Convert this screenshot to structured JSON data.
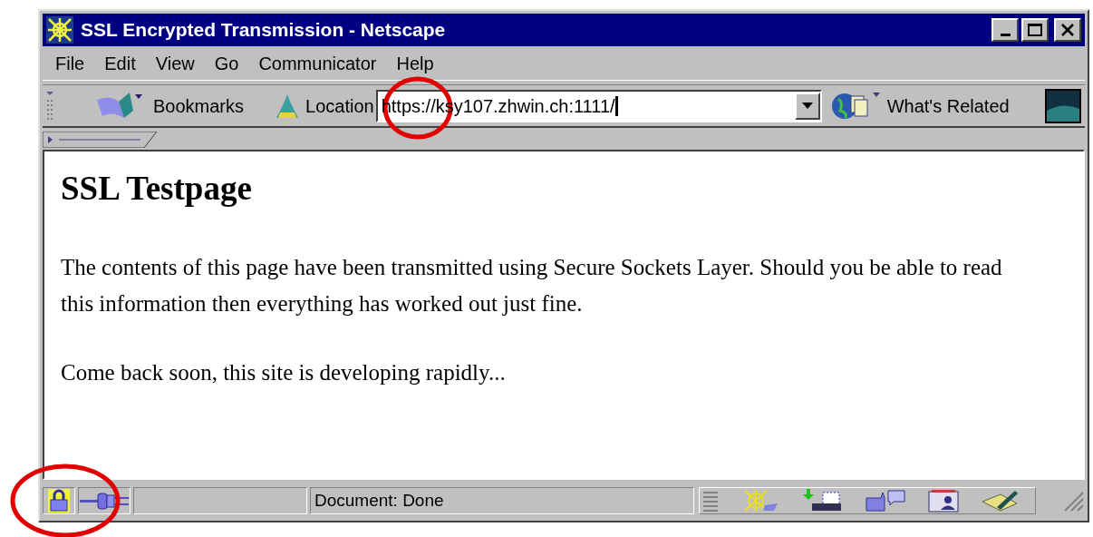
{
  "window": {
    "title": "SSL Encrypted Transmission - Netscape"
  },
  "menu": [
    "File",
    "Edit",
    "View",
    "Go",
    "Communicator",
    "Help"
  ],
  "toolbar": {
    "bookmarks": "Bookmarks",
    "location_label": "Location",
    "location_value": "https://ksy107.zhwin.ch:1111/",
    "whats_related": "What's Related"
  },
  "page": {
    "heading": "SSL Testpage",
    "paragraphs": [
      "The contents of this page have been transmitted using Secure Sockets Layer. Should you be able to read this information then everything has worked out just fine.",
      "Come back soon, this site is developing rapidly..."
    ]
  },
  "status_bar": {
    "secure": true,
    "text": "Document: Done"
  }
}
